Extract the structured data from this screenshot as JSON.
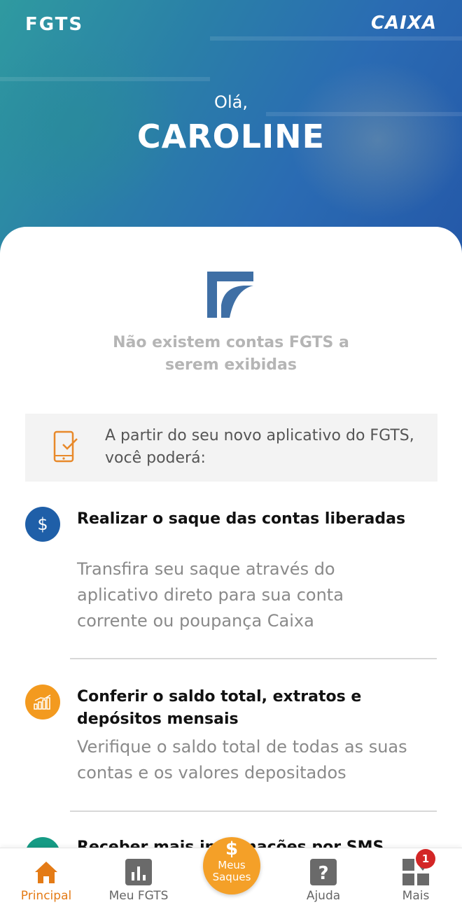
{
  "header": {
    "brand_left": "FGTS",
    "brand_right": "CAIXA",
    "greeting": "Olá,",
    "user_name": "CAROLINE"
  },
  "empty_state": {
    "message": "Não existem contas FGTS a serem exibidas"
  },
  "intro": {
    "text": "A partir do seu novo aplicativo do FGTS, você poderá:"
  },
  "features": [
    {
      "icon": "dollar-icon",
      "icon_color": "#1f5fa8",
      "title": "Realizar o saque das contas liberadas",
      "description": "Transfira seu saque através do aplicativo direto para sua conta corrente ou poupança Caixa"
    },
    {
      "icon": "growth-chart-icon",
      "icon_color": "#f39a1f",
      "title": "Conferir o saldo total, extratos e depósitos mensais",
      "description": "Verifique o saldo total de todas as suas contas e os valores depositados"
    },
    {
      "icon": "sms-icon",
      "icon_color": "#169b85",
      "title": "Receber mais informações por SMS"
    }
  ],
  "bottom_nav": {
    "items": [
      {
        "label": "Principal",
        "icon": "home-icon",
        "active": true
      },
      {
        "label": "Meu FGTS",
        "icon": "bar-chart-icon",
        "active": false
      },
      {
        "label": "Ajuda",
        "icon": "help-icon",
        "active": false
      },
      {
        "label": "Mais",
        "icon": "grid-icon",
        "active": false
      }
    ],
    "fab": {
      "symbol": "$",
      "line1": "Meus",
      "line2": "Saques"
    },
    "badge_count": "1"
  },
  "colors": {
    "accent": "#e47b16",
    "brand_blue": "#2a6bb3",
    "fab": "#f4a028",
    "badge": "#d32626"
  }
}
